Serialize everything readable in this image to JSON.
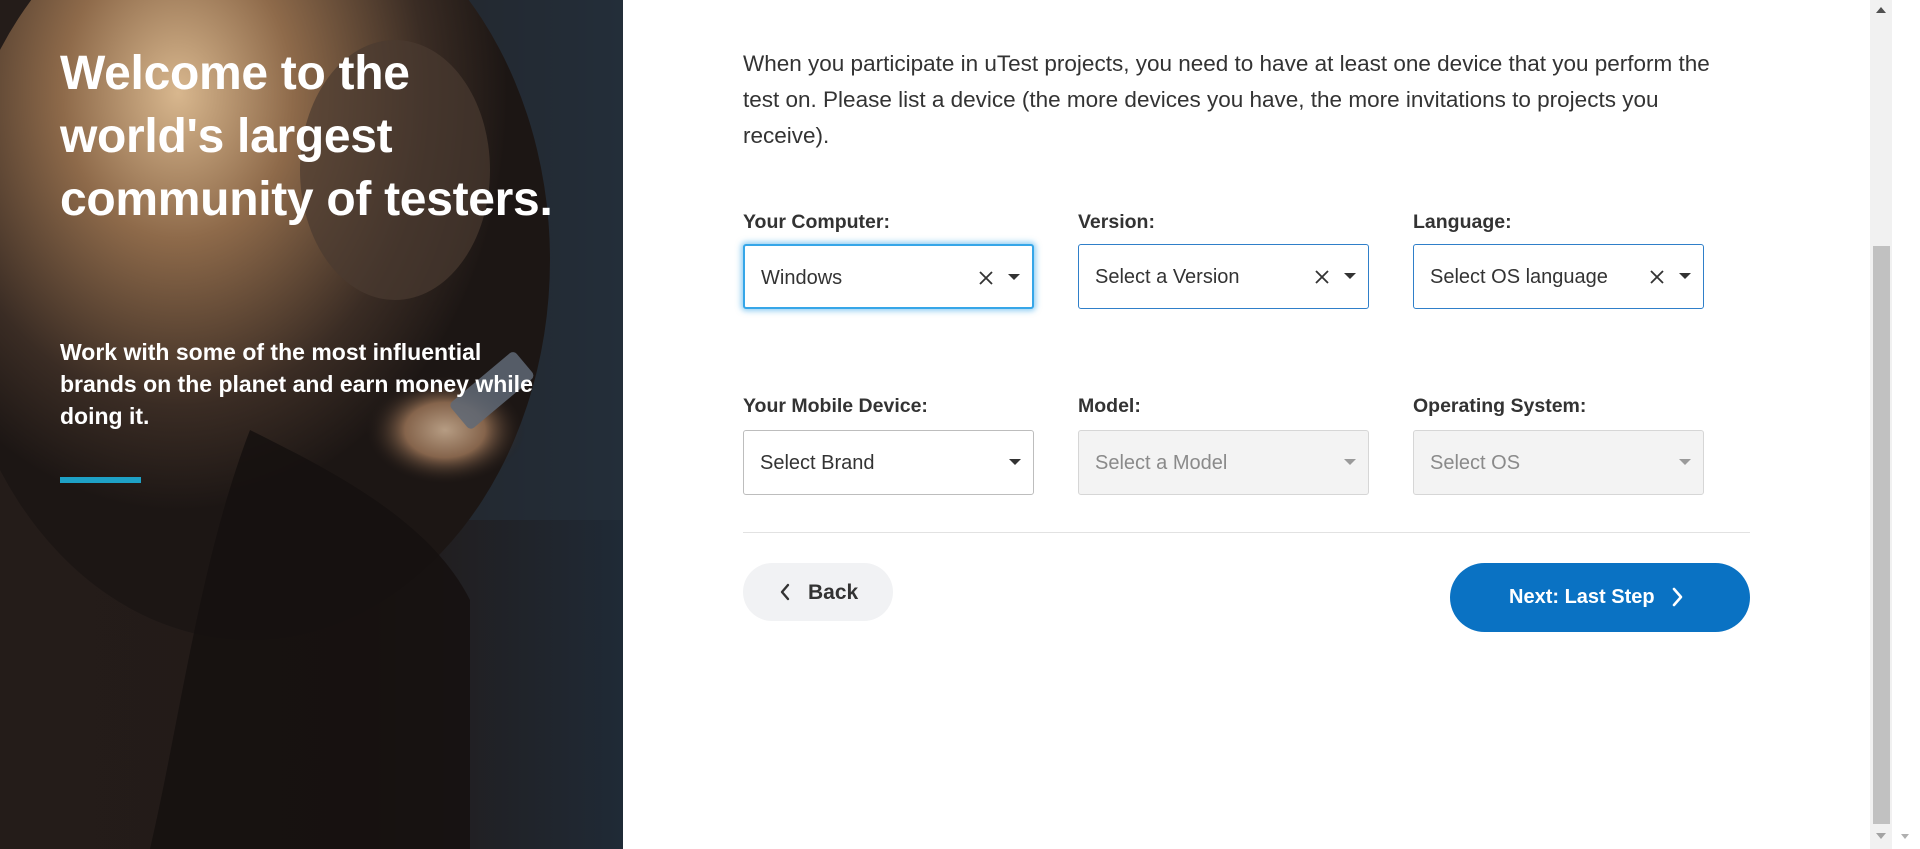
{
  "hero": {
    "title": "Welcome to the world's largest community of testers.",
    "subtitle": "Work with some of the most influential brands on the planet and earn money while doing it."
  },
  "form": {
    "intro": "When you participate in uTest projects, you need to have at least one device that you perform the test on. Please list a device (the more devices you have, the more invitations to projects you receive).",
    "computer": {
      "label": "Your Computer:",
      "value": "Windows"
    },
    "version": {
      "label": "Version:",
      "value": "Select a Version"
    },
    "language": {
      "label": "Language:",
      "value": "Select OS language"
    },
    "mobile": {
      "label": "Your Mobile Device:",
      "value": "Select Brand"
    },
    "model": {
      "label": "Model:",
      "value": "Select a Model"
    },
    "os": {
      "label": "Operating System:",
      "value": "Select OS"
    }
  },
  "buttons": {
    "back": "Back",
    "next": "Next: Last Step"
  },
  "colors": {
    "primary": "#0a72c3",
    "accent": "#1ea1c6",
    "focus": "#36a6e8"
  },
  "icons": {
    "clear": "close-icon",
    "caret": "caret-down-icon",
    "back": "chevron-left-icon",
    "next": "chevron-right-icon"
  }
}
